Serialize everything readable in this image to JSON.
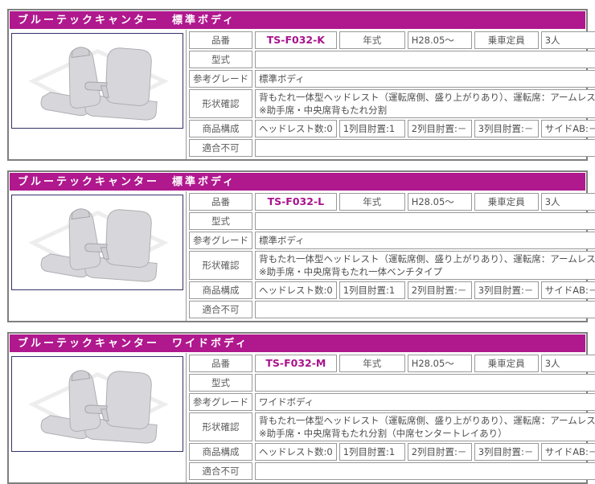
{
  "colors": {
    "accent": "#b0188e",
    "part_number_text": "#a8128c",
    "label_cell_bg": "#c6c6c6",
    "cell_border": "#999999",
    "section_border": "#7f7f7f",
    "image_box_border": "#32326b"
  },
  "icons": {
    "seat_illustration": "truck-seat-line-drawing"
  },
  "labels": {
    "part_no": "品番",
    "model": "型式",
    "grade": "参考グレード",
    "shape": "形状確認",
    "composition": "商品構成",
    "incompatible": "適合不可",
    "year": "年式",
    "capacity": "乗車定員"
  },
  "sections": [
    {
      "title": "ブルーテックキャンター　標準ボディ",
      "part_no": "TS-F032-K",
      "year": "H28.05～",
      "capacity": "3人",
      "model": "",
      "grade": "標準ボディ",
      "shape_line1": "背もたれ一体型ヘッドレスト（運転席側、盛り上がりあり）、運転席：アームレストあり",
      "shape_line2": "※助手席・中央席背もたれ分割",
      "composition": [
        "ヘッドレスト数:0",
        "1列目肘置:1",
        "2列目肘置:－",
        "3列目肘置:－",
        "サイドAB:－"
      ],
      "incompatible": ""
    },
    {
      "title": "ブルーテックキャンター　標準ボディ",
      "part_no": "TS-F032-L",
      "year": "H28.05～",
      "capacity": "3人",
      "model": "",
      "grade": "標準ボディ",
      "shape_line1": "背もたれ一体型ヘッドレスト（運転席側、盛り上がりあり）、運転席：アームレストあり",
      "shape_line2": "※助手席・中央席背もたれ一体ベンチタイプ",
      "composition": [
        "ヘッドレスト数:0",
        "1列目肘置:1",
        "2列目肘置:－",
        "3列目肘置:－",
        "サイドAB:－"
      ],
      "incompatible": ""
    },
    {
      "title": "ブルーテックキャンター　ワイドボディ",
      "part_no": "TS-F032-M",
      "year": "H28.05～",
      "capacity": "3人",
      "model": "",
      "grade": "ワイドボディ",
      "shape_line1": "背もたれ一体型ヘッドレスト（運転席側、盛り上がりあり）、運転席：アームレストあり",
      "shape_line2": "※助手席・中央席背もたれ分割（中席センタートレイあり）",
      "composition": [
        "ヘッドレスト数:0",
        "1列目肘置:1",
        "2列目肘置:－",
        "3列目肘置:－",
        "サイドAB:－"
      ],
      "incompatible": ""
    }
  ]
}
